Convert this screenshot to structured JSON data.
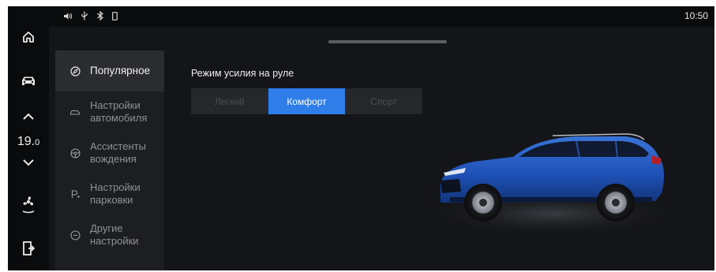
{
  "status_bar": {
    "icons": [
      "volume-icon",
      "usb-icon",
      "bluetooth-icon",
      "phone-icon"
    ],
    "time": "10:50"
  },
  "rail": {
    "temperature_main": "19.",
    "temperature_decimal": "0",
    "items": [
      "home-icon",
      "car-icon",
      "chevron-up-icon",
      "chevron-down-icon",
      "fan-icon",
      "door-exit-icon"
    ]
  },
  "menu": {
    "items": [
      {
        "label": "Популярное",
        "icon": "compass-icon",
        "active": true
      },
      {
        "label": "Настройки\nавтомобиля",
        "icon": "car-outline-icon",
        "active": false
      },
      {
        "label": "Ассистенты\nвождения",
        "icon": "steering-wheel-icon",
        "active": false
      },
      {
        "label": "Настройки\nпарковки",
        "icon": "parking-icon",
        "active": false
      },
      {
        "label": "Другие\nнастройки",
        "icon": "more-icon",
        "active": false
      }
    ]
  },
  "steering": {
    "title": "Режим усилия на руле",
    "options": [
      "Легкий",
      "Комфорт",
      "Спорт"
    ],
    "selected": "Комфорт"
  },
  "colors": {
    "accent": "#2f7de8",
    "background": "#141518",
    "menu_bg": "#1d1e22"
  }
}
